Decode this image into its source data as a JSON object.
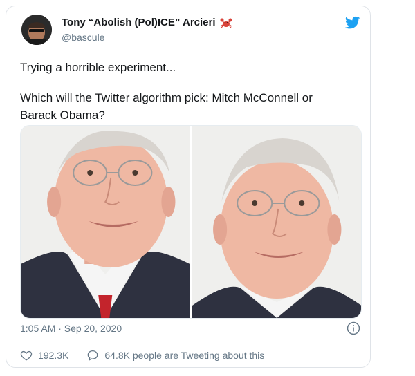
{
  "tweet": {
    "author_name": "Tony “Abolish (Pol)ICE” Arcieri",
    "author_handle": "@bascule",
    "text_line1": "Trying a horrible experiment...",
    "text_line2": "Which will the Twitter algorithm pick: Mitch McConnell or Barack Obama?",
    "timestamp": "1:05 AM · Sep 20, 2020",
    "likes": "192.3K",
    "replies_text": "64.8K people are Tweeting about this"
  },
  "colors": {
    "twitter_blue": "#1da1f2",
    "text_primary": "#14171a",
    "text_secondary": "#657786"
  },
  "icons": [
    "crab-emoji-icon",
    "twitter-bird-icon",
    "info-icon",
    "heart-icon",
    "speech-bubble-icon"
  ]
}
